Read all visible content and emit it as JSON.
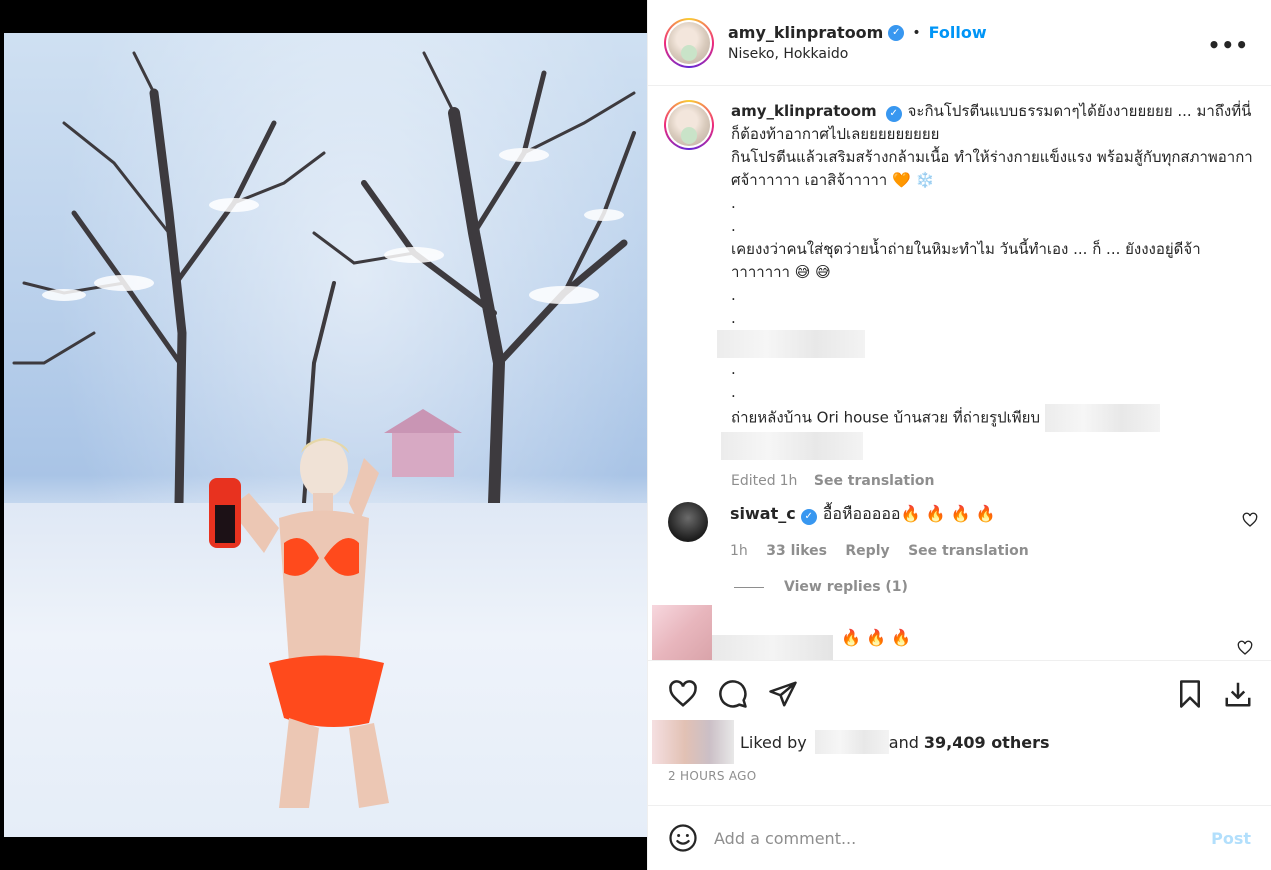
{
  "header": {
    "username": "amy_klinpratoom",
    "dot": "•",
    "follow_label": "Follow",
    "location": "Niseko, Hokkaido",
    "more_label": "•••"
  },
  "caption": {
    "username": "amy_klinpratoom",
    "line1": "จะกินโปรตีนแบบธรรมดาๆได้ยังงายยยยย ... มาถึงที่นี่ ก็ต้องท้าอากาศไปเลยยยยยยยยย",
    "line2": "กินโปรตีนแล้วเสริมสร้างกล้ามเนื้อ ทำให้ร่างกายแข็งแรง พร้อมสู้กับทุกสภาพอากาศจ้าาาาาา เอาสิจ้าาาาา 🧡 ❄️",
    "dot": ".",
    "line3": "เคยงงว่าคนใส่ชุดว่ายน้ำถ่ายในหิมะทำไม วันนี้ทำเอง ... ก็ ... ยังงงอยู่ดีจ้าาาาาาาา 😅 😅",
    "line4": "ถ่ายหลังบ้าน Ori house บ้านสวย ที่ถ่ายรูปเพียบ",
    "edited": "Edited",
    "time": "1h",
    "see_translation": "See translation"
  },
  "comment1": {
    "username": "siwat_c",
    "text": "อื้อหือออออ🔥 🔥 🔥 🔥",
    "time": "1h",
    "likes": "33 likes",
    "reply": "Reply",
    "see_translation": "See translation",
    "view_replies": "View replies (1)"
  },
  "comment2": {
    "text": "🔥 🔥 🔥"
  },
  "likes": {
    "prefix": "Liked by",
    "suffix": "and",
    "count": "39,409 others"
  },
  "timestamp": "2 HOURS AGO",
  "add_comment": {
    "placeholder": "Add a comment...",
    "post_label": "Post"
  },
  "colors": {
    "link": "#0095f6",
    "verified": "#3897f0",
    "secondary_text": "#8e8e8e",
    "post_disabled": "#b2dffc"
  }
}
